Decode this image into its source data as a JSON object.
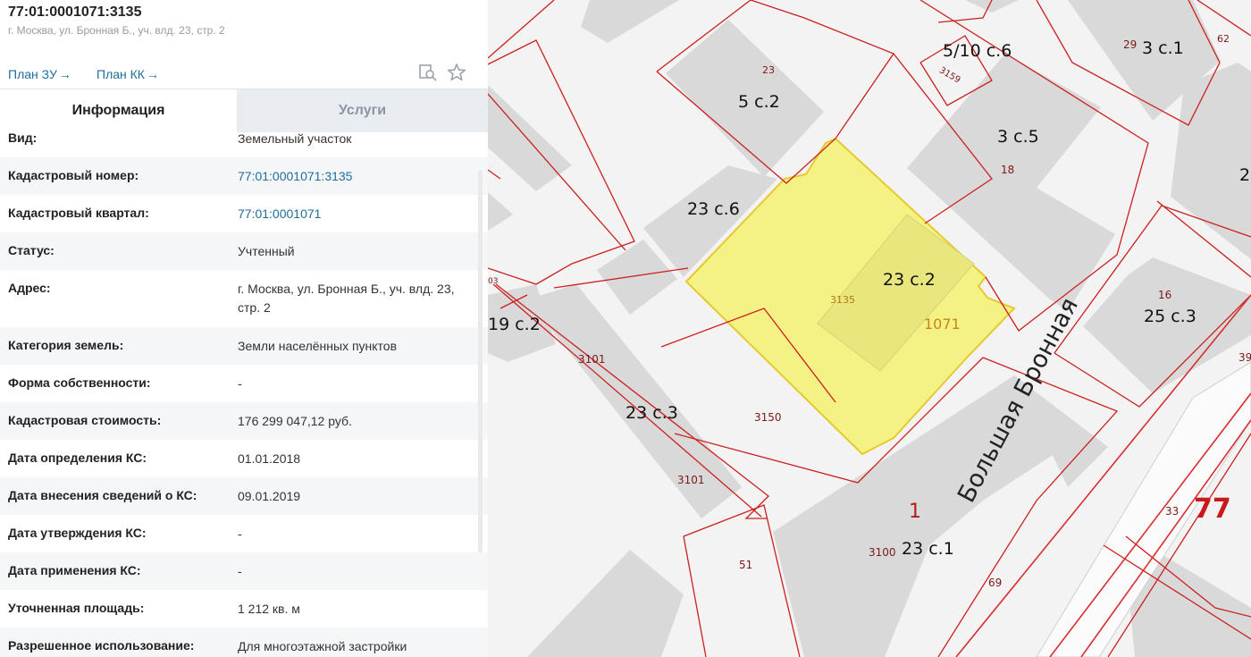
{
  "header": {
    "title": "77:01:0001071:3135",
    "subtitle": "г. Москва, ул. Бронная Б., уч. влд. 23, стр. 2",
    "plan_zu": "План ЗУ",
    "plan_kk": "План КК",
    "arrow": "→",
    "icons": [
      "map-search-icon",
      "star-icon"
    ]
  },
  "tabs": {
    "info": "Информация",
    "services": "Услуги"
  },
  "fields": [
    {
      "label": "Вид:",
      "value": "Земельный участок"
    },
    {
      "label": "Кадастровый номер:",
      "value": "77:01:0001071:3135"
    },
    {
      "label": "Кадастровый квартал:",
      "value": "77:01:0001071"
    },
    {
      "label": "Статус:",
      "value": "Учтенный"
    },
    {
      "label": "Адрес:",
      "value": "г. Москва, ул. Бронная Б., уч. влд. 23, стр. 2"
    },
    {
      "label": "Категория земель:",
      "value": "Земли населённых пунктов"
    },
    {
      "label": "Форма собственности:",
      "value": "-"
    },
    {
      "label": "Кадастровая стоимость:",
      "value": "176 299 047,12 руб."
    },
    {
      "label": "Дата определения КС:",
      "value": "01.01.2018"
    },
    {
      "label": "Дата внесения сведений о КС:",
      "value": "09.01.2019"
    },
    {
      "label": "Дата утверждения КС:",
      "value": "-"
    },
    {
      "label": "Дата применения КС:",
      "value": "-"
    },
    {
      "label": "Уточненная площадь:",
      "value": "1 212 кв. м"
    },
    {
      "label": "Разрешенное использование:",
      "value": "Для многоэтажной застройки"
    }
  ],
  "map": {
    "buildings": [
      "5/10 с.6",
      "3 с.1",
      "5 с.2",
      "3 с.5",
      "23 с.6",
      "23 с.2",
      "19 с.2",
      "25 с.3",
      "23 с.3",
      "23 с.1",
      "2"
    ],
    "parcels": [
      "62",
      "29",
      "23",
      "3159",
      "18",
      "3135",
      "1071",
      "16",
      "3101",
      "3101",
      "3150",
      "39",
      "1",
      "33",
      "3100",
      "51",
      "69",
      "03"
    ],
    "district": "77",
    "street": "Большая Бронная",
    "colors": {
      "parcel_border": "#cc1f1f",
      "highlight_fill": "#f5f285",
      "building_fill": "#d9d9d9",
      "background": "#f3f3f3"
    }
  }
}
